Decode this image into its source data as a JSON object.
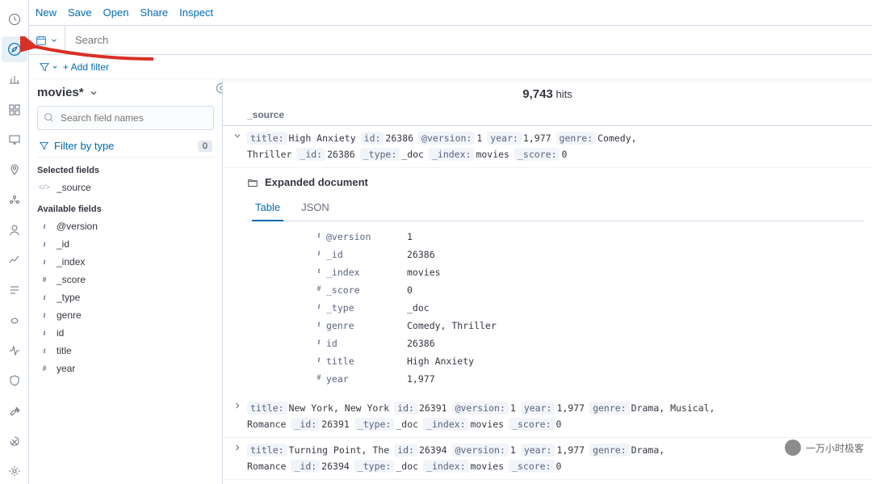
{
  "topbar": {
    "new": "New",
    "save": "Save",
    "open": "Open",
    "share": "Share",
    "inspect": "Inspect"
  },
  "search": {
    "placeholder": "Search"
  },
  "filterbar": {
    "add_filter": "+ Add filter"
  },
  "sidebar": {
    "index_pattern": "movies*",
    "field_search_placeholder": "Search field names",
    "filter_by_type": "Filter by type",
    "filter_by_type_count": "0",
    "selected_fields_label": "Selected fields",
    "available_fields_label": "Available fields",
    "selected_fields": [
      {
        "name": "_source",
        "type": "src"
      }
    ],
    "available_fields": [
      {
        "name": "@version",
        "type": "t"
      },
      {
        "name": "_id",
        "type": "t"
      },
      {
        "name": "_index",
        "type": "t"
      },
      {
        "name": "_score",
        "type": "num"
      },
      {
        "name": "_type",
        "type": "t"
      },
      {
        "name": "genre",
        "type": "t"
      },
      {
        "name": "id",
        "type": "t"
      },
      {
        "name": "title",
        "type": "t"
      },
      {
        "name": "year",
        "type": "num"
      }
    ]
  },
  "results": {
    "hits_number": "9,743",
    "hits_label": "hits",
    "column_header": "_source",
    "expanded_label": "Expanded document",
    "tab_table": "Table",
    "tab_json": "JSON",
    "rows": [
      {
        "expanded": true,
        "fields": [
          {
            "k": "title:",
            "v": "High Anxiety"
          },
          {
            "k": "id:",
            "v": "26386"
          },
          {
            "k": "@version:",
            "v": "1"
          },
          {
            "k": "year:",
            "v": "1,977"
          },
          {
            "k": "genre:",
            "v": "Comedy, Thriller"
          },
          {
            "k": "_id:",
            "v": "26386"
          },
          {
            "k": "_type:",
            "v": "_doc"
          },
          {
            "k": "_index:",
            "v": "movies"
          },
          {
            "k": "_score:",
            "v": "0"
          }
        ]
      },
      {
        "expanded": false,
        "fields": [
          {
            "k": "title:",
            "v": "New York, New York"
          },
          {
            "k": "id:",
            "v": "26391"
          },
          {
            "k": "@version:",
            "v": "1"
          },
          {
            "k": "year:",
            "v": "1,977"
          },
          {
            "k": "genre:",
            "v": "Drama, Musical, Romance"
          },
          {
            "k": "_id:",
            "v": "26391"
          },
          {
            "k": "_type:",
            "v": "_doc"
          },
          {
            "k": "_index:",
            "v": "movies"
          },
          {
            "k": "_score:",
            "v": "0"
          }
        ]
      },
      {
        "expanded": false,
        "fields": [
          {
            "k": "title:",
            "v": "Turning Point, The"
          },
          {
            "k": "id:",
            "v": "26394"
          },
          {
            "k": "@version:",
            "v": "1"
          },
          {
            "k": "year:",
            "v": "1,977"
          },
          {
            "k": "genre:",
            "v": "Drama, Romance"
          },
          {
            "k": "_id:",
            "v": "26394"
          },
          {
            "k": "_type:",
            "v": "_doc"
          },
          {
            "k": "_index:",
            "v": "movies"
          },
          {
            "k": "_score:",
            "v": "0"
          }
        ]
      }
    ],
    "expanded_doc": [
      {
        "type": "t",
        "k": "@version",
        "v": "1"
      },
      {
        "type": "t",
        "k": "_id",
        "v": "26386"
      },
      {
        "type": "t",
        "k": "_index",
        "v": "movies"
      },
      {
        "type": "num",
        "k": "_score",
        "v": "0"
      },
      {
        "type": "t",
        "k": "_type",
        "v": "_doc"
      },
      {
        "type": "t",
        "k": "genre",
        "v": "Comedy, Thriller"
      },
      {
        "type": "t",
        "k": "id",
        "v": "26386"
      },
      {
        "type": "t",
        "k": "title",
        "v": "High Anxiety"
      },
      {
        "type": "num",
        "k": "year",
        "v": "1,977"
      }
    ]
  },
  "watermark": "一万小时极客"
}
